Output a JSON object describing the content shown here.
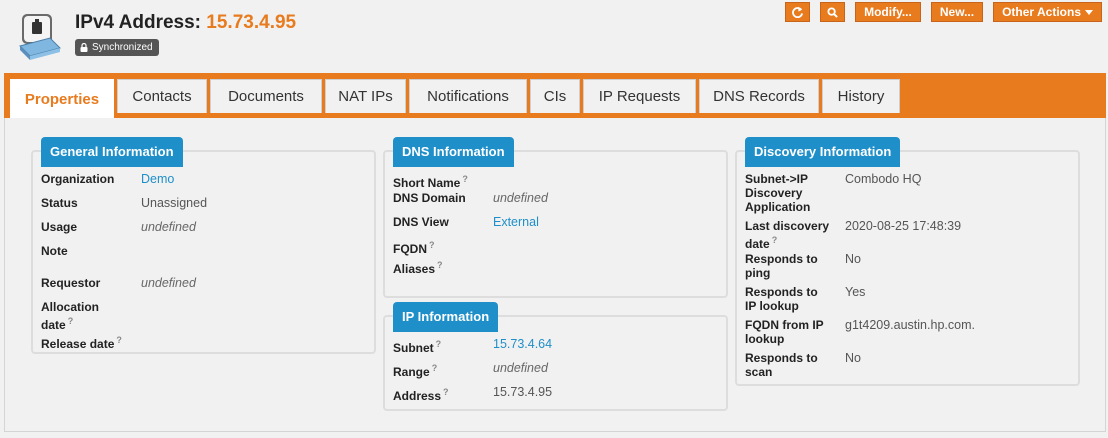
{
  "header": {
    "title_label": "IPv4 Address:",
    "title_value": "15.73.4.95",
    "sync_badge": "Synchronized",
    "icon": "network-port-icon"
  },
  "actions": {
    "refresh_icon": "refresh-icon",
    "search_icon": "search-icon",
    "modify": "Modify...",
    "new": "New...",
    "other_actions": "Other Actions",
    "accent": "#e87b1e"
  },
  "tabs": [
    {
      "label": "Properties",
      "active": true
    },
    {
      "label": "Contacts"
    },
    {
      "label": "Documents"
    },
    {
      "label": "NAT IPs"
    },
    {
      "label": "Notifications"
    },
    {
      "label": "CIs"
    },
    {
      "label": "IP Requests"
    },
    {
      "label": "DNS Records"
    },
    {
      "label": "History"
    }
  ],
  "general": {
    "title": "General Information",
    "organization_label": "Organization",
    "organization_value": "Demo",
    "status_label": "Status",
    "status_value": "Unassigned",
    "usage_label": "Usage",
    "usage_value": "undefined",
    "note_label": "Note",
    "requestor_label": "Requestor",
    "requestor_value": "undefined",
    "allocation_label_1": "Allocation",
    "allocation_label_2": "date",
    "release_label": "Release date"
  },
  "dns": {
    "title": "DNS Information",
    "short_name_label": "Short Name",
    "dns_domain_label": "DNS Domain",
    "dns_domain_value": "undefined",
    "dns_view_label": "DNS View",
    "dns_view_value": "External",
    "fqdn_label": "FQDN",
    "aliases_label": "Aliases"
  },
  "ip": {
    "title": "IP Information",
    "subnet_label": "Subnet",
    "subnet_value": "15.73.4.64",
    "range_label": "Range",
    "range_value": "undefined",
    "address_label": "Address",
    "address_value": "15.73.4.95"
  },
  "discovery": {
    "title": "Discovery Information",
    "app_label_1": "Subnet->IP",
    "app_label_2": "Discovery",
    "app_label_3": "Application",
    "app_value": "Combodo HQ",
    "last_label_1": "Last discovery",
    "last_label_2": "date",
    "last_value": "2020-08-25 17:48:39",
    "ping_label_1": "Responds to",
    "ping_label_2": "ping",
    "ping_value": "No",
    "iplookup_label_1": "Responds to",
    "iplookup_label_2": "IP lookup",
    "iplookup_value": "Yes",
    "fqdn_label_1": "FQDN from IP",
    "fqdn_label_2": "lookup",
    "fqdn_value": "g1t4209.austin.hp.com.",
    "scan_label_1": "Responds to",
    "scan_label_2": "scan",
    "scan_value": "No"
  },
  "help_mark": "?"
}
